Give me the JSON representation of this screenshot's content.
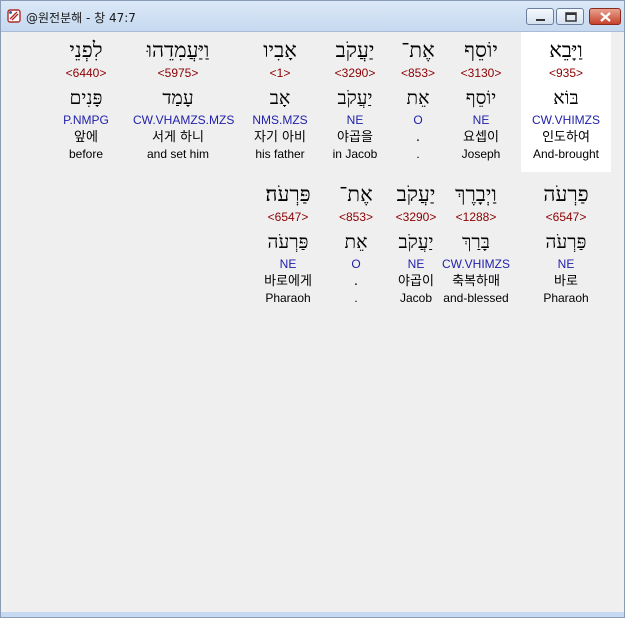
{
  "window": {
    "title": "@원전분해 - 창 47:7",
    "icons": {
      "app": "scroll-app-icon",
      "minimize": "minimize-icon",
      "maximize": "maximize-icon",
      "close": "close-icon"
    },
    "colors": {
      "strong": "#8b0000",
      "morph": "#1f1fa8",
      "selected_bg": "#ffffff"
    }
  },
  "rows": [
    {
      "words": [
        {
          "heb": "וַיָּבֵא",
          "strong": "<935>",
          "lemma": "בּוֹא",
          "morph": "CW.VHIMZS",
          "kor": "인도하여",
          "eng": "And-brought",
          "selected": true
        },
        {
          "heb": "יוֹסֵף",
          "strong": "<3130>",
          "lemma": "יוֹסֵף",
          "morph": "NE",
          "kor": "요셉이",
          "eng": "Joseph"
        },
        {
          "heb": "אֶת־",
          "strong": "<853>",
          "lemma": "אֵת",
          "morph": "O",
          "kor": ".",
          "eng": "."
        },
        {
          "heb": "יַעֲקֹב",
          "strong": "<3290>",
          "lemma": "יַעֲקֹב",
          "morph": "NE",
          "kor": "야곱을",
          "eng": "in Jacob"
        },
        {
          "heb": "אָבִיו",
          "strong": "<1>",
          "lemma": "אָב",
          "morph": "NMS.MZS",
          "kor": "자기 아비",
          "eng": "his father"
        },
        {
          "heb": "וַיַּעֲמִדֵהוּ",
          "strong": "<5975>",
          "lemma": "עָמַד",
          "morph": "CW.VHAMZS.MZS",
          "kor": "서게 하니",
          "eng": "and set him"
        },
        {
          "heb": "לִפְנֵי",
          "strong": "<6440>",
          "lemma": "פָּנִים",
          "morph": "P.NMPG",
          "kor": "앞에",
          "eng": "before"
        }
      ]
    },
    {
      "words": [
        {
          "heb": "פַרְעֹה",
          "strong": "<6547>",
          "lemma": "פַּרְעֹה",
          "morph": "NE",
          "kor": "바로",
          "eng": "Pharaoh"
        },
        {
          "heb": "וַיְבָרֶךְ",
          "strong": "<1288>",
          "lemma": "בָּרַךְ",
          "morph": "CW.VHIMZS",
          "kor": "축복하매",
          "eng": "and-blessed"
        },
        {
          "heb": "יַעֲקֹב",
          "strong": "<3290>",
          "lemma": "יַעֲקֹב",
          "morph": "NE",
          "kor": "야곱이",
          "eng": "Jacob"
        },
        {
          "heb": "אֶת־",
          "strong": "<853>",
          "lemma": "אֵת",
          "morph": "O",
          "kor": ".",
          "eng": "."
        },
        {
          "heb": "פַּרְעֹה׃",
          "strong": "<6547>",
          "lemma": "פַּרְעֹה",
          "morph": "NE",
          "kor": "바로에게",
          "eng": "Pharaoh"
        }
      ]
    }
  ]
}
